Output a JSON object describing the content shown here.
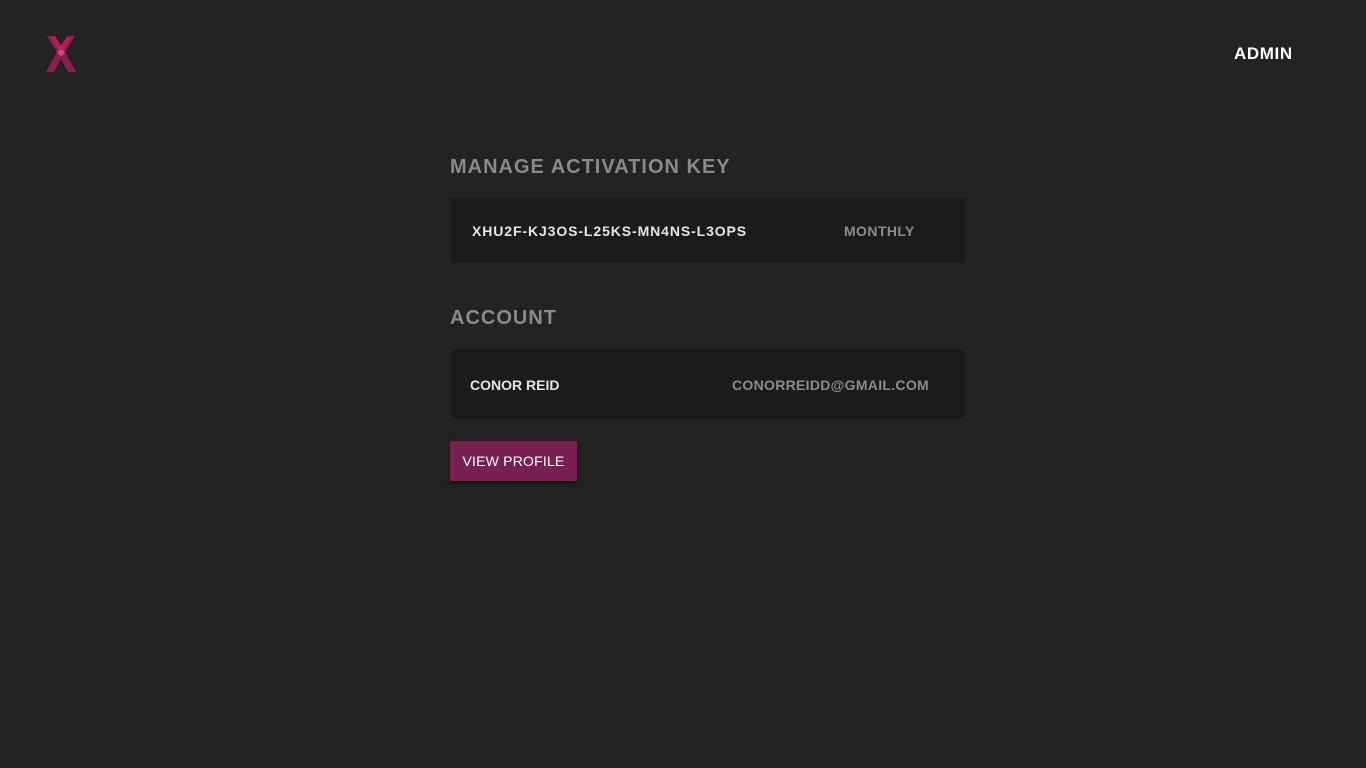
{
  "header": {
    "logo_icon": "x-logo-icon",
    "admin_label": "ADMIN"
  },
  "activation": {
    "title": "MANAGE ACTIVATION KEY",
    "key": "XHU2F-KJ3OS-L25KS-MN4NS-L3OPS",
    "plan": "MONTHLY"
  },
  "account": {
    "title": "ACCOUNT",
    "name": "CONOR REID",
    "email": "CONORREIDD@GMAIL.COM",
    "view_profile_label": "VIEW PROFILE"
  },
  "colors": {
    "background": "#232323",
    "card": "#1b1b1b",
    "accent": "#7a1f52",
    "logo": "#c2185b"
  }
}
